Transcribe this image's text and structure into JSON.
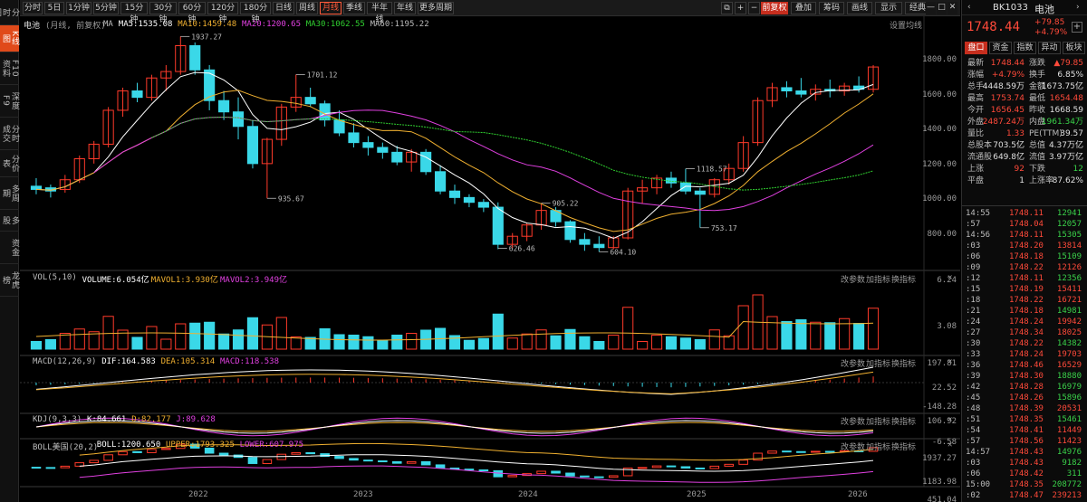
{
  "left_rail": [
    {
      "label": "分时图",
      "active": false
    },
    {
      "label": "K线图",
      "active": true
    },
    {
      "label": "F10资料",
      "active": false
    },
    {
      "label": "深度F9",
      "active": false
    },
    {
      "label": "分时成交",
      "active": false
    },
    {
      "label": "分价表",
      "active": false
    },
    {
      "label": "多周期",
      "active": false
    },
    {
      "label": "多股",
      "active": false
    },
    {
      "label": "资金",
      "active": false
    },
    {
      "label": "龙虎榜",
      "active": false
    }
  ],
  "toolbar": {
    "periods": [
      "分时",
      "5日",
      "1分钟",
      "5分钟",
      "15分钟",
      "30分钟",
      "60分钟",
      "120分钟",
      "180分钟",
      "日线",
      "周线",
      "月线",
      "季线",
      "半年线",
      "年线",
      "更多周期"
    ],
    "active_period": "月线",
    "right_buttons": [
      "前复权",
      "叠加",
      "筹码",
      "画线",
      "显示",
      "经典"
    ],
    "icon_buttons": [
      "copy-icon",
      "plus-icon",
      "minus-icon"
    ]
  },
  "main_chart": {
    "title": "电池",
    "subtitle": "(月线, 前复权)",
    "ma_labels": [
      {
        "text": "MA",
        "color": "#bdbdbd"
      },
      {
        "text": "MA5:1535.08",
        "color": "#ffffff"
      },
      {
        "text": "MA10:1459.48",
        "color": "#f0b030"
      },
      {
        "text": "MA20:1200.65",
        "color": "#e040e0"
      },
      {
        "text": "MA30:1062.55",
        "color": "#30d030"
      },
      {
        "text": "MA60:1195.22",
        "color": "#bdbdbd"
      }
    ],
    "settings_label": "设置均线",
    "y_ticks": [
      "1800.00",
      "1600.00",
      "1400.00",
      "1200.00",
      "1000.00",
      "800.00"
    ],
    "annotations": [
      "1937.27",
      "1701.12",
      "935.67",
      "905.22",
      "626.46",
      "604.10",
      "1118.57",
      "753.17"
    ]
  },
  "vol_panel": {
    "labels": [
      {
        "text": "VOL(5,10)",
        "color": "#bdbdbd"
      },
      {
        "text": "VOLUME:6.054亿",
        "color": "#ffffff"
      },
      {
        "text": "MAVOL1:3.930亿",
        "color": "#f0b030"
      },
      {
        "text": "MAVOL2:3.949亿",
        "color": "#e040e0"
      }
    ],
    "y_ticks": [
      "6.24",
      "3.08"
    ],
    "buttons": [
      "改参数",
      "加指标",
      "换指标"
    ]
  },
  "macd_panel": {
    "labels": [
      {
        "text": "MACD(12,26,9)",
        "color": "#bdbdbd"
      },
      {
        "text": "DIF:164.583",
        "color": "#ffffff"
      },
      {
        "text": "DEA:105.314",
        "color": "#f0b030"
      },
      {
        "text": "MACD:118.538",
        "color": "#e040e0"
      }
    ],
    "y_ticks": [
      "197.81",
      "22.52",
      "-148.28"
    ],
    "buttons": [
      "改参数",
      "加指标",
      "换指标"
    ]
  },
  "kdj_panel": {
    "labels": [
      {
        "text": "KDJ(9,3,3)",
        "color": "#bdbdbd"
      },
      {
        "text": "K:84.661",
        "color": "#ffffff"
      },
      {
        "text": "D:82.177",
        "color": "#f0b030"
      },
      {
        "text": "J:89.628",
        "color": "#e040e0"
      }
    ],
    "y_ticks": [
      "106.92",
      "-6.58"
    ],
    "buttons": [
      "改参数",
      "加指标",
      "换指标"
    ]
  },
  "boll_panel": {
    "labels": [
      {
        "text": "BOLL美国(20,2)",
        "color": "#bdbdbd"
      },
      {
        "text": "BOLL:1200.650",
        "color": "#ffffff"
      },
      {
        "text": "UPPER:1793.325",
        "color": "#f0b030"
      },
      {
        "text": "LOWER:607.975",
        "color": "#e040e0"
      }
    ],
    "y_ticks": [
      "1937.27",
      "1183.98",
      "451.04"
    ],
    "buttons": [
      "改参数",
      "加指标",
      "换指标"
    ]
  },
  "x_axis": [
    "2022",
    "2023",
    "2024",
    "2025",
    "2026"
  ],
  "side": {
    "code": "BK1033",
    "name": "电池",
    "price": "1748.44",
    "change": "+79.85",
    "change_pct": "+4.79%",
    "tabs": [
      "盘口",
      "资金",
      "指数",
      "异动",
      "板块"
    ],
    "active_tab": "盘口",
    "stats": [
      {
        "k1": "最新",
        "v1": "1748.44",
        "c1": "red",
        "k2": "涨跌",
        "v2": "▲79.85",
        "c2": "red"
      },
      {
        "k1": "涨幅",
        "v1": "+4.79%",
        "c1": "red",
        "k2": "换手",
        "v2": "6.85%",
        "c2": "white"
      },
      {
        "k1": "总手",
        "v1": "4448.59万",
        "c1": "white",
        "k2": "金额",
        "v2": "1673.75亿",
        "c2": "white"
      },
      {
        "k1": "最高",
        "v1": "1753.74",
        "c1": "red",
        "k2": "最低",
        "v2": "1654.48",
        "c2": "red"
      },
      {
        "k1": "今开",
        "v1": "1656.45",
        "c1": "red",
        "k2": "昨收",
        "v2": "1668.59",
        "c2": "white"
      },
      {
        "k1": "外盘",
        "v1": "2487.24万",
        "c1": "red",
        "k2": "内盘",
        "v2": "1961.34万",
        "c2": "green"
      },
      {
        "k1": "量比",
        "v1": "1.33",
        "c1": "red",
        "k2": "PE(TTM)",
        "v2": "39.57",
        "c2": "white"
      },
      {
        "k1": "总股本",
        "v1": "703.5亿",
        "c1": "white",
        "k2": "总值",
        "v2": "4.37万亿",
        "c2": "white"
      },
      {
        "k1": "流通股",
        "v1": "649.8亿",
        "c1": "white",
        "k2": "流值",
        "v2": "3.97万亿",
        "c2": "white"
      },
      {
        "k1": "上涨",
        "v1": "92",
        "c1": "red",
        "k2": "下跌",
        "v2": "12",
        "c2": "green"
      },
      {
        "k1": "平盘",
        "v1": "1",
        "c1": "white",
        "k2": "上涨率",
        "v2": "87.62%",
        "c2": "white"
      }
    ],
    "ticks": [
      {
        "t": "14:55",
        "p": "1748.11",
        "v": "12941",
        "c": "green"
      },
      {
        "t": ":57",
        "p": "1748.04",
        "v": "12057",
        "c": "green"
      },
      {
        "t": "14:56",
        "p": "1748.11",
        "v": "15305",
        "c": "green"
      },
      {
        "t": ":03",
        "p": "1748.20",
        "v": "13814",
        "c": "red"
      },
      {
        "t": ":06",
        "p": "1748.18",
        "v": "15109",
        "c": "green"
      },
      {
        "t": ":09",
        "p": "1748.22",
        "v": "12126",
        "c": "red"
      },
      {
        "t": ":12",
        "p": "1748.11",
        "v": "12356",
        "c": "green"
      },
      {
        "t": ":15",
        "p": "1748.19",
        "v": "15411",
        "c": "red"
      },
      {
        "t": ":18",
        "p": "1748.22",
        "v": "16721",
        "c": "red"
      },
      {
        "t": ":21",
        "p": "1748.18",
        "v": "14981",
        "c": "green"
      },
      {
        "t": ":24",
        "p": "1748.24",
        "v": "19942",
        "c": "red"
      },
      {
        "t": ":27",
        "p": "1748.34",
        "v": "18025",
        "c": "red"
      },
      {
        "t": ":30",
        "p": "1748.22",
        "v": "14382",
        "c": "green"
      },
      {
        "t": ":33",
        "p": "1748.24",
        "v": "19703",
        "c": "red"
      },
      {
        "t": ":36",
        "p": "1748.46",
        "v": "16529",
        "c": "red"
      },
      {
        "t": ":39",
        "p": "1748.30",
        "v": "18880",
        "c": "green"
      },
      {
        "t": ":42",
        "p": "1748.28",
        "v": "16979",
        "c": "green"
      },
      {
        "t": ":45",
        "p": "1748.26",
        "v": "15896",
        "c": "green"
      },
      {
        "t": ":48",
        "p": "1748.39",
        "v": "20531",
        "c": "red"
      },
      {
        "t": ":51",
        "p": "1748.35",
        "v": "15461",
        "c": "green"
      },
      {
        "t": ":54",
        "p": "1748.41",
        "v": "11449",
        "c": "red"
      },
      {
        "t": ":57",
        "p": "1748.56",
        "v": "11423",
        "c": "red"
      },
      {
        "t": "14:57",
        "p": "1748.43",
        "v": "14976",
        "c": "green"
      },
      {
        "t": ":03",
        "p": "1748.43",
        "v": "9182",
        "c": "green"
      },
      {
        "t": ":06",
        "p": "1748.42",
        "v": "311",
        "c": "green"
      },
      {
        "t": "15:00",
        "p": "1748.35",
        "v": "208772",
        "c": "green"
      },
      {
        "t": ":02",
        "p": "1748.47",
        "v": "239213",
        "c": "red"
      }
    ]
  }
}
